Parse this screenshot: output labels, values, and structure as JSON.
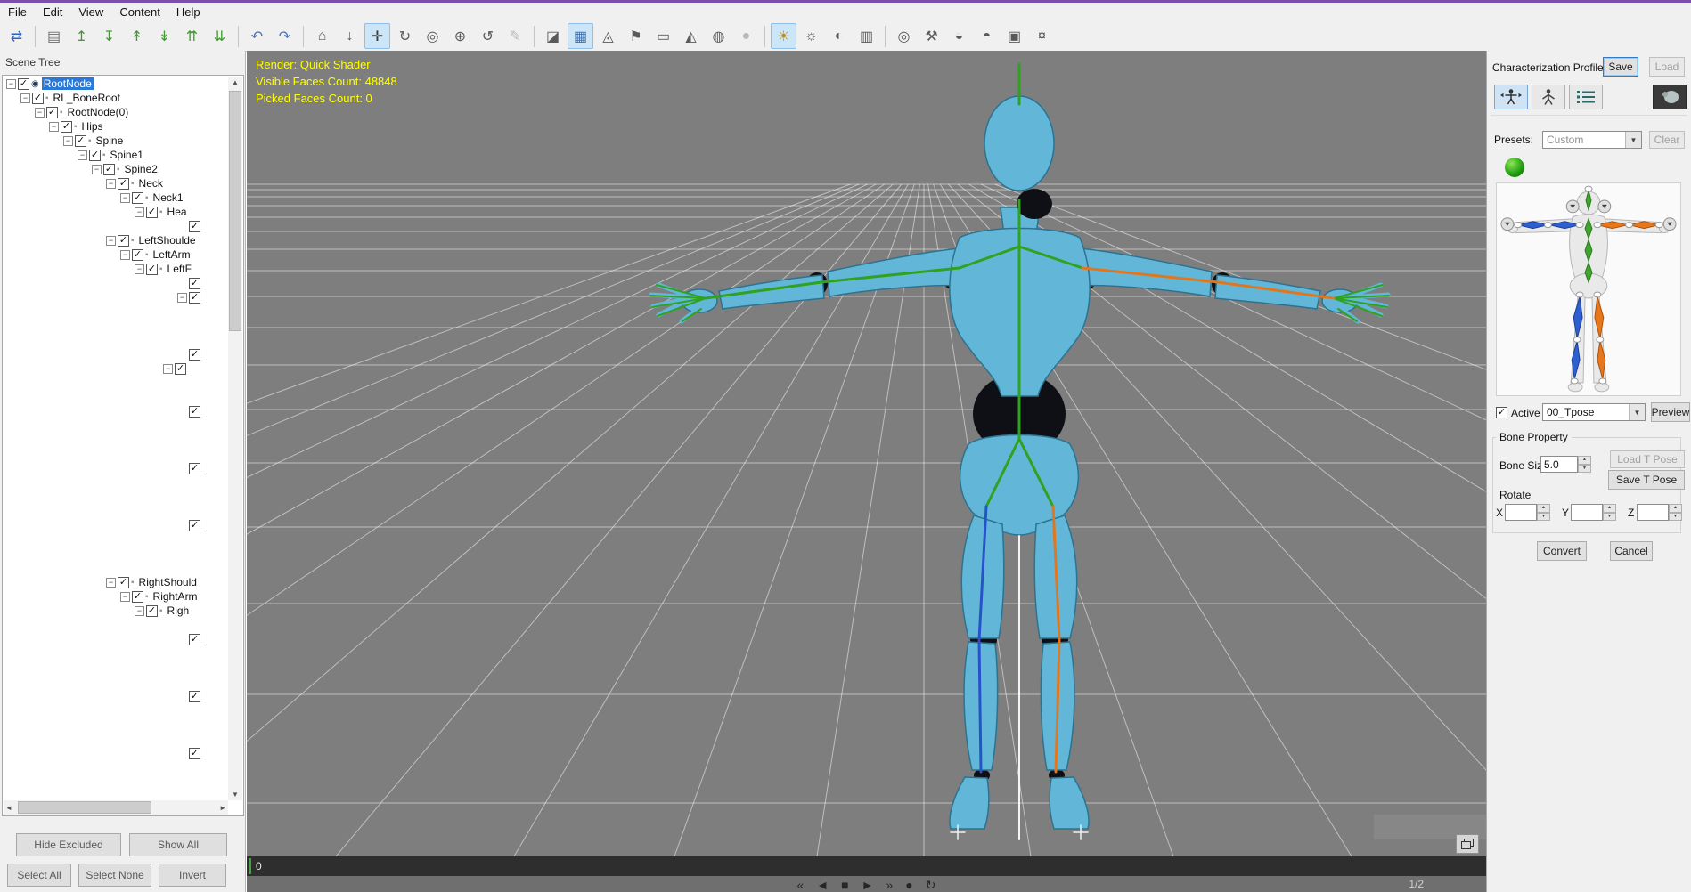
{
  "window": {
    "menu_items": [
      "File",
      "Edit",
      "View",
      "Content",
      "Help"
    ]
  },
  "colors": {
    "accent_top": "#7b4fae",
    "tree_selection": "#2b79d7",
    "stats_text": "#ffff00",
    "bone_left": "#2753c8",
    "bone_right": "#e2761d",
    "bone_center": "#2fa31f",
    "character_skin": "#62b7d8",
    "viewport_background": "#7e7e7e"
  },
  "toolbar": {
    "items": [
      {
        "name": "pipeline-transfer-icon",
        "glyph": "⇄",
        "color": "#2a62c8"
      },
      {
        "type": "sep"
      },
      {
        "name": "open-file-icon",
        "glyph": "▤",
        "color": "#6b6b6b"
      },
      {
        "name": "export-up-icon",
        "glyph": "↥",
        "color": "#3f9a30"
      },
      {
        "name": "export-down-icon",
        "glyph": "↧",
        "color": "#3f9a30"
      },
      {
        "name": "export-model-icon",
        "glyph": "↟",
        "color": "#3f9a30"
      },
      {
        "name": "export-motion-icon",
        "glyph": "↡",
        "color": "#3f9a30"
      },
      {
        "name": "export-all-icon",
        "glyph": "⇈",
        "color": "#3f9a30"
      },
      {
        "name": "apply-to-scene-icon",
        "glyph": "⇊",
        "color": "#3f9a30"
      },
      {
        "type": "sep"
      },
      {
        "name": "undo-icon",
        "glyph": "↶",
        "color": "#4a6fb0"
      },
      {
        "name": "redo-icon",
        "glyph": "↷",
        "color": "#4a6fb0"
      },
      {
        "type": "sep"
      },
      {
        "name": "align-to-ground-icon",
        "glyph": "⌂",
        "color": "#5a5a5a"
      },
      {
        "name": "move-down-icon",
        "glyph": "↓",
        "color": "#5a5a5a"
      },
      {
        "name": "move-tool-icon",
        "glyph": "✛",
        "color": "#3a3a3a",
        "state": "selected"
      },
      {
        "name": "rotate-tool-icon",
        "glyph": "↻",
        "color": "#5a5a5a"
      },
      {
        "name": "pick-axis-icon",
        "glyph": "◎",
        "color": "#5a5a5a"
      },
      {
        "name": "global-transform-icon",
        "glyph": "⊕",
        "color": "#5a5a5a"
      },
      {
        "name": "orbit-tool-icon",
        "glyph": "↺",
        "color": "#5a5a5a"
      },
      {
        "name": "edit-mesh-icon",
        "glyph": "✎",
        "state": "disabled"
      },
      {
        "type": "sep"
      },
      {
        "name": "invert-display-icon",
        "glyph": "◪",
        "color": "#5a5a5a"
      },
      {
        "name": "grid-toggle-icon",
        "glyph": "▦",
        "color": "#3f6fa8",
        "state": "selected"
      },
      {
        "name": "gizmo-icon",
        "glyph": "◬",
        "color": "#5a5a5a"
      },
      {
        "name": "pin-icon",
        "glyph": "⚑",
        "color": "#5a5a5a"
      },
      {
        "name": "bounding-box-icon",
        "glyph": "▭",
        "color": "#5a5a5a"
      },
      {
        "name": "measure-icon",
        "glyph": "◭",
        "color": "#5a5a5a"
      },
      {
        "name": "world-axis-icon",
        "glyph": "◍",
        "color": "#5a5a5a"
      },
      {
        "name": "env-sphere-icon",
        "glyph": "●",
        "state": "disabled"
      },
      {
        "type": "sep"
      },
      {
        "name": "interactive-light-icon",
        "glyph": "☀",
        "color": "#c08a20",
        "state": "selected"
      },
      {
        "name": "key-light-icon",
        "glyph": "☼",
        "color": "#5a5a5a"
      },
      {
        "name": "ambient-light-icon",
        "glyph": "◐",
        "color": "#5a5a5a"
      },
      {
        "name": "stage-icon",
        "glyph": "▥",
        "color": "#5a5a5a"
      },
      {
        "type": "sep"
      },
      {
        "name": "environment-icon",
        "glyph": "◎",
        "color": "#5a5a5a"
      },
      {
        "name": "wrench-tool-icon",
        "glyph": "⚒",
        "color": "#5a5a5a"
      },
      {
        "name": "material-sphere-icon",
        "glyph": "◒",
        "color": "#5a5a5a"
      },
      {
        "name": "texture-sphere-icon",
        "glyph": "◓",
        "color": "#5a5a5a"
      },
      {
        "name": "snapshot-icon",
        "glyph": "▣",
        "color": "#5a5a5a"
      },
      {
        "name": "content-store-icon",
        "glyph": "¤",
        "color": "#5a5a5a"
      }
    ]
  },
  "scene_tree": {
    "title": "Scene Tree",
    "rows": [
      {
        "l": "RootNode",
        "i": 0,
        "e": true,
        "s": true,
        "ic": "root"
      },
      {
        "l": "RL_BoneRoot",
        "i": 1,
        "e": true
      },
      {
        "l": "RootNode(0)",
        "i": 2,
        "e": true
      },
      {
        "l": "Hips",
        "i": 3,
        "e": true
      },
      {
        "l": "Spine",
        "i": 4,
        "e": true
      },
      {
        "l": "Spine1",
        "i": 5,
        "e": true
      },
      {
        "l": "Spine2",
        "i": 6,
        "e": true
      },
      {
        "l": "Neck",
        "i": 7,
        "e": true
      },
      {
        "l": "Neck1",
        "i": 8,
        "e": true
      },
      {
        "l": "Hea",
        "i": 9,
        "e": true
      },
      {
        "l": "",
        "i": 12,
        "e": false
      },
      {
        "l": "LeftShoulde",
        "i": 7,
        "e": true
      },
      {
        "l": "LeftArm",
        "i": 8,
        "e": true
      },
      {
        "l": "LeftF",
        "i": 9,
        "e": true
      },
      {
        "l": "",
        "i": 12,
        "e": false
      },
      {
        "l": "",
        "i": 12,
        "e": true
      },
      {
        "l": "",
        "i": 15,
        "e": false
      },
      {
        "l": "",
        "i": 15,
        "e": false
      },
      {
        "l": "",
        "i": 15,
        "e": false
      },
      {
        "l": "",
        "i": 12,
        "e": false
      },
      {
        "l": "",
        "i": 11,
        "e": true
      },
      {
        "l": "",
        "i": 15,
        "e": false
      },
      {
        "l": "",
        "i": 15,
        "e": false
      },
      {
        "l": "",
        "i": 12,
        "e": false
      },
      {
        "l": "",
        "i": 15,
        "e": false
      },
      {
        "l": "",
        "i": 15,
        "e": false
      },
      {
        "l": "",
        "i": 15,
        "e": false
      },
      {
        "l": "",
        "i": 12,
        "e": false
      },
      {
        "l": "",
        "i": 15,
        "e": false
      },
      {
        "l": "",
        "i": 15,
        "e": false
      },
      {
        "l": "",
        "i": 15,
        "e": false
      },
      {
        "l": "",
        "i": 12,
        "e": false
      },
      {
        "l": "",
        "i": 15,
        "e": false
      },
      {
        "l": "",
        "i": 15,
        "e": false
      },
      {
        "l": "",
        "i": 15,
        "e": false
      },
      {
        "l": "RightShould",
        "i": 7,
        "e": true
      },
      {
        "l": "RightArm",
        "i": 8,
        "e": true
      },
      {
        "l": "Righ",
        "i": 9,
        "e": true
      },
      {
        "l": "",
        "i": 15,
        "e": false
      },
      {
        "l": "",
        "i": 12,
        "e": false
      },
      {
        "l": "",
        "i": 15,
        "e": false
      },
      {
        "l": "",
        "i": 15,
        "e": false
      },
      {
        "l": "",
        "i": 15,
        "e": false
      },
      {
        "l": "",
        "i": 12,
        "e": false
      },
      {
        "l": "",
        "i": 15,
        "e": false
      },
      {
        "l": "",
        "i": 15,
        "e": false
      },
      {
        "l": "",
        "i": 15,
        "e": false
      },
      {
        "l": "",
        "i": 12,
        "e": false
      },
      {
        "l": "",
        "i": 15,
        "e": false
      },
      {
        "l": "",
        "i": 15,
        "e": false
      }
    ],
    "actions_row1": [
      "Hide Excluded",
      "Show All"
    ],
    "actions_row2": [
      "Select All",
      "Select None",
      "Invert"
    ]
  },
  "viewport": {
    "stats": [
      "Render: Quick Shader",
      "Visible Faces Count: 48848",
      "Picked Faces Count: 0"
    ],
    "timeline": {
      "start_label": "0",
      "fraction": "1/2"
    },
    "playback": [
      {
        "name": "go-to-start-button",
        "glyph": "«"
      },
      {
        "name": "step-back-button",
        "glyph": "◄"
      },
      {
        "name": "stop-button",
        "glyph": "■"
      },
      {
        "name": "play-button",
        "glyph": "►"
      },
      {
        "name": "step-forward-button",
        "glyph": "»"
      },
      {
        "name": "record-button",
        "glyph": "●"
      },
      {
        "name": "loop-button",
        "glyph": "↻"
      }
    ]
  },
  "characterization": {
    "title": "Characterization Profile",
    "save": "Save",
    "load": "Load",
    "presets_label": "Presets:",
    "preset_value": "Custom",
    "clear": "Clear",
    "active_label": "Active",
    "pose_value": "00_Tpose",
    "preview": "Preview",
    "bone_property": "Bone Property",
    "bone_size_label": "Bone Size",
    "bone_size_value": "5.0",
    "load_t_pose": "Load T Pose",
    "save_t_pose": "Save T Pose",
    "rotate_label": "Rotate",
    "axis_labels": [
      "X",
      "Y",
      "Z"
    ],
    "convert": "Convert",
    "cancel": "Cancel"
  }
}
